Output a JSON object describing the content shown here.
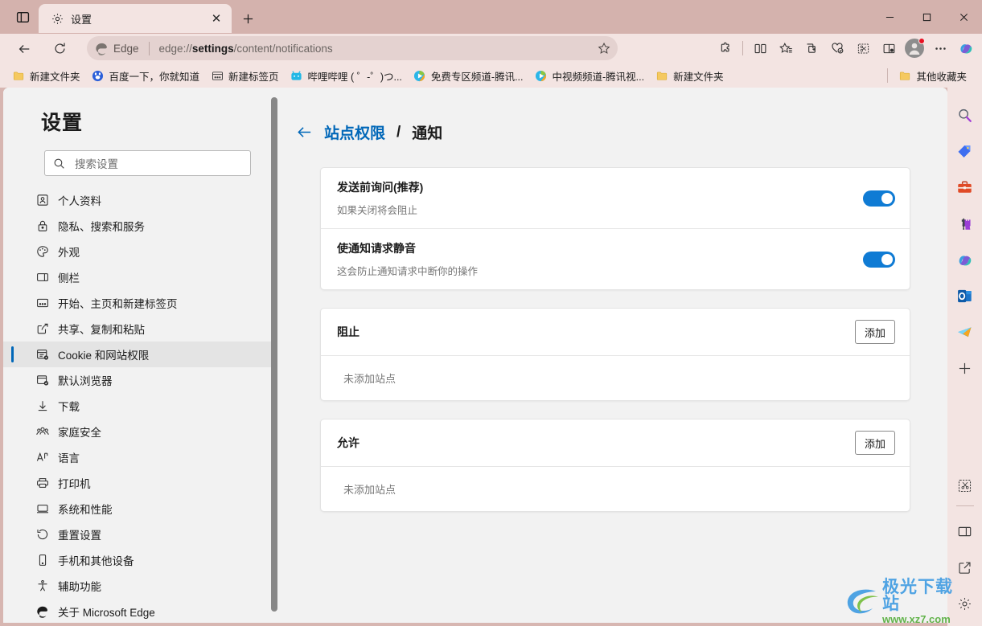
{
  "window": {
    "minimize_label": "—",
    "maximize_label": "□",
    "close_label": "✕"
  },
  "tabbar": {
    "tab_search_icon": "tab-actions-icon",
    "new_tab_label": "+",
    "tabs": [
      {
        "title": "设置",
        "favicon": "gear-icon",
        "close_label": "✕",
        "active": true
      }
    ]
  },
  "toolbar": {
    "back_icon": "back-arrow-icon",
    "refresh_icon": "refresh-icon",
    "brand_label": "Edge",
    "url_prefix": "edge://",
    "url_bold": "settings",
    "url_suffix": "/content/notifications",
    "full_url": "edge://settings/content/notifications",
    "star_icon": "favorite-star-icon",
    "right_icons": [
      "extensions-icon",
      "split-screen-icon",
      "favorites-icon",
      "collections-icon",
      "browser-essentials-icon",
      "drop-icon",
      "read-aloud-icon"
    ],
    "profile_icon": "profile-avatar",
    "more_label": "⋯",
    "copilot_icon": "copilot-icon"
  },
  "bookmarks": {
    "items": [
      {
        "label": "新建文件夹",
        "icon": "folder-icon"
      },
      {
        "label": "百度一下，你就知道",
        "icon": "baidu-icon"
      },
      {
        "label": "新建标签页",
        "icon": "newtab-icon"
      },
      {
        "label": "哔哩哔哩 ( ゜-゜)つ...",
        "icon": "bilibili-icon"
      },
      {
        "label": "免费专区频道-腾讯...",
        "icon": "tencent-video-icon"
      },
      {
        "label": "中视频频道-腾讯视...",
        "icon": "tencent-video-icon"
      },
      {
        "label": "新建文件夹",
        "icon": "folder-icon"
      }
    ],
    "other_favorites": {
      "label": "其他收藏夹",
      "icon": "folder-icon"
    }
  },
  "settings": {
    "title": "设置",
    "search": {
      "placeholder": "搜索设置",
      "value": "",
      "icon": "search-icon"
    },
    "nav_items": [
      {
        "label": "个人资料",
        "icon": "profile-icon",
        "active": false
      },
      {
        "label": "隐私、搜索和服务",
        "icon": "lock-icon",
        "active": false
      },
      {
        "label": "外观",
        "icon": "palette-icon",
        "active": false
      },
      {
        "label": "侧栏",
        "icon": "sidebar-icon",
        "active": false
      },
      {
        "label": "开始、主页和新建标签页",
        "icon": "home-icon",
        "active": false
      },
      {
        "label": "共享、复制和粘贴",
        "icon": "share-icon",
        "active": false
      },
      {
        "label": "Cookie 和网站权限",
        "icon": "cookie-permissions-icon",
        "active": true
      },
      {
        "label": "默认浏览器",
        "icon": "default-browser-icon",
        "active": false
      },
      {
        "label": "下载",
        "icon": "download-icon",
        "active": false
      },
      {
        "label": "家庭安全",
        "icon": "family-icon",
        "active": false
      },
      {
        "label": "语言",
        "icon": "language-icon",
        "active": false
      },
      {
        "label": "打印机",
        "icon": "printer-icon",
        "active": false
      },
      {
        "label": "系统和性能",
        "icon": "system-icon",
        "active": false
      },
      {
        "label": "重置设置",
        "icon": "reset-icon",
        "active": false
      },
      {
        "label": "手机和其他设备",
        "icon": "phone-icon",
        "active": false
      },
      {
        "label": "辅助功能",
        "icon": "accessibility-icon",
        "active": false
      },
      {
        "label": "关于 Microsoft Edge",
        "icon": "edge-logo-icon",
        "active": false
      }
    ]
  },
  "page": {
    "breadcrumb": {
      "back_icon": "back-arrow-icon",
      "parent": "站点权限",
      "separator": "/",
      "current": "通知"
    },
    "toggle_rows": [
      {
        "title": "发送前询问(推荐)",
        "subtitle": "如果关闭将会阻止",
        "state": "on"
      },
      {
        "title": "使通知请求静音",
        "subtitle": "这会防止通知请求中断你的操作",
        "state": "on"
      }
    ],
    "site_lists": [
      {
        "title": "阻止",
        "add_label": "添加",
        "empty_text": "未添加站点"
      },
      {
        "title": "允许",
        "add_label": "添加",
        "empty_text": "未添加站点"
      }
    ]
  },
  "edge_sidebar": {
    "top_icons": [
      "search-icon",
      "shopping-tag-icon",
      "tools-briefcase-icon",
      "games-icon",
      "copilot-m365-icon",
      "outlook-icon",
      "telegram-icon",
      "add-app-icon"
    ],
    "bottom_icons": [
      "screenshot-icon",
      "split-view-icon",
      "open-external-icon",
      "settings-gear-icon"
    ]
  },
  "watermark": {
    "title": "极光下载站",
    "url": "www.xz7.com"
  },
  "colors": {
    "titlebar": "#d4b2ad",
    "toolbar": "#f3e4e2",
    "accent_blue": "#0067b8",
    "toggle_on": "#0f7bd4",
    "page_bg": "#f2f2f2",
    "card_bg": "#ffffff"
  }
}
